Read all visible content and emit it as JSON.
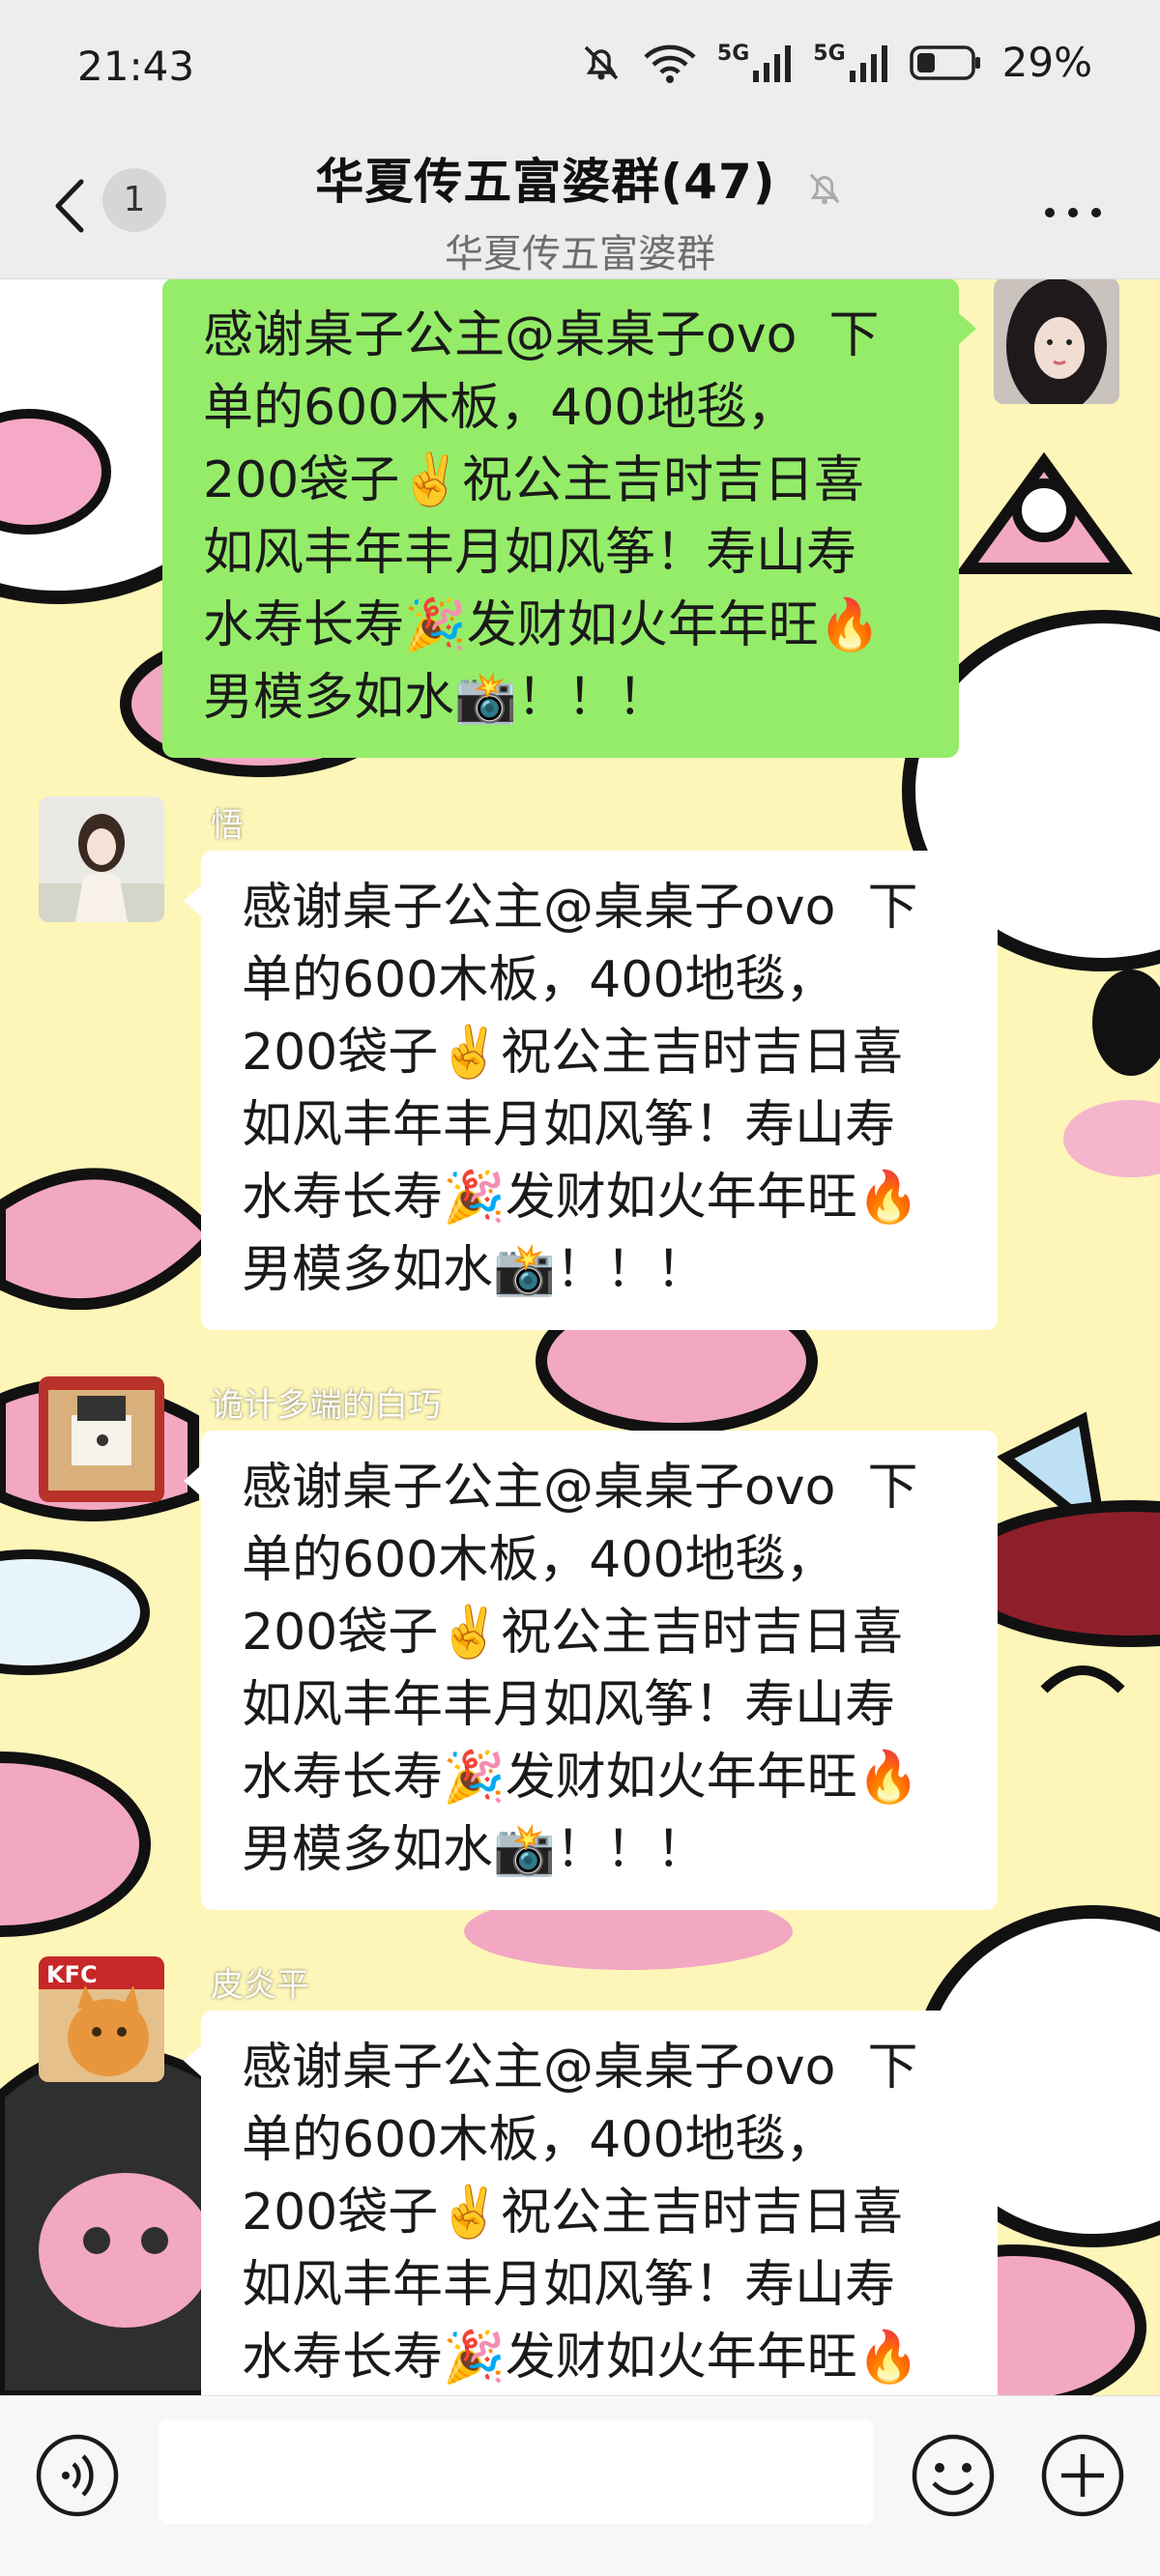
{
  "status_bar": {
    "time": "21:43",
    "signal1_label": "5G",
    "signal2_label": "5G",
    "battery": "29%",
    "icons": [
      "mute-bell-icon",
      "wifi-icon",
      "signal-5g-icon",
      "signal-5g-icon",
      "battery-icon"
    ]
  },
  "header": {
    "unread_count": "1",
    "title": "华夏传五富婆群(47)",
    "subtitle": "华夏传五富婆群",
    "icons": [
      "back-arrow-icon",
      "mute-icon",
      "more-dots-icon"
    ]
  },
  "messages": [
    {
      "direction": "out",
      "sender": "",
      "text": "感谢桌子公主@桌桌子ovo  下\n单的600木板，400地毯，\n200袋子✌️祝公主吉时吉日喜\n如风丰年丰月如风筝！寿山寿\n水寿长寿🎉发财如火年年旺🔥\n男模多如水📸！！！"
    },
    {
      "direction": "in",
      "sender": "悟",
      "text": "感谢桌子公主@桌桌子ovo  下\n单的600木板，400地毯，\n200袋子✌️祝公主吉时吉日喜\n如风丰年丰月如风筝！寿山寿\n水寿长寿🎉发财如火年年旺🔥\n男模多如水📸！！！"
    },
    {
      "direction": "in",
      "sender": "诡计多端的白巧",
      "text": "感谢桌子公主@桌桌子ovo  下\n单的600木板，400地毯，\n200袋子✌️祝公主吉时吉日喜\n如风丰年丰月如风筝！寿山寿\n水寿长寿🎉发财如火年年旺🔥\n男模多如水📸！！！"
    },
    {
      "direction": "in",
      "sender": "皮炎平",
      "avatar_text": "KFC",
      "text": "感谢桌子公主@桌桌子ovo  下\n单的600木板，400地毯，\n200袋子✌️祝公主吉时吉日喜\n如风丰年丰月如风筝！寿山寿\n水寿长寿🎉发财如火年年旺🔥"
    }
  ],
  "input_bar": {
    "placeholder": "",
    "icons": [
      "voice-icon",
      "emoji-icon",
      "plus-icon"
    ]
  },
  "colors": {
    "outgoing_bubble": "#95ec69",
    "incoming_bubble": "#ffffff",
    "bar_background": "#ededed",
    "wallpaper_yellow": "#fdf6b8",
    "wallpaper_pink": "#f2a7c3"
  }
}
